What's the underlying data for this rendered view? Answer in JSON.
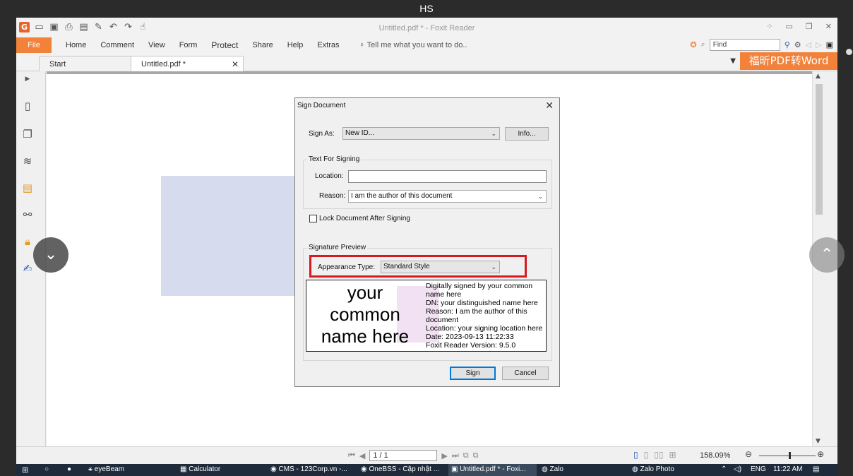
{
  "viewer": {
    "title": "HS"
  },
  "app": {
    "window_title": "Untitled.pdf * - Foxit Reader",
    "qa_icons": [
      "foxit-logo-icon",
      "open-folder-icon",
      "save-icon",
      "print-icon",
      "scan-icon",
      "new-icon",
      "undo-icon",
      "redo-icon",
      "hand-icon"
    ],
    "ribbon": {
      "file": "File",
      "tabs": [
        "Home",
        "Comment",
        "View",
        "Form",
        "Protect",
        "Share",
        "Help",
        "Extras"
      ],
      "tell_me": "Tell me what you want to do..",
      "find_placeholder": "Find"
    },
    "brand_banner": "福昕PDF转Word",
    "doc_tabs": {
      "start": "Start",
      "active": "Untitled.pdf *"
    }
  },
  "dialog": {
    "title": "Sign Document",
    "sign_as_label": "Sign As:",
    "sign_as_value": "New ID...",
    "info_button": "Info...",
    "text_group": "Text For Signing",
    "location_label": "Location:",
    "location_value": "",
    "reason_label": "Reason:",
    "reason_value": "I am the author of this document",
    "lock_label": "Lock Document After Signing",
    "lock_checked": false,
    "preview_group": "Signature Preview",
    "appearance_label": "Appearance Type:",
    "appearance_value": "Standard Style",
    "preview_name_lines": [
      "your",
      "common",
      "name here"
    ],
    "preview_info_lines": [
      "Digitally signed by your common",
      "name here",
      "DN: your distinguished name here",
      "Reason: I am the author of this",
      "document",
      "Location: your signing location here",
      "Date: 2023-09-13 11:22:33",
      "Foxit Reader Version: 9.5.0"
    ],
    "sign_button": "Sign",
    "cancel_button": "Cancel"
  },
  "status": {
    "page": "1 / 1",
    "zoom": "158.09%"
  },
  "taskbar": {
    "items": [
      "eyeBeam",
      "Calculator",
      "CMS - 123Corp.vn -...",
      "OneBSS - Cập nhật ...",
      "Untitled.pdf * - Foxi...",
      "Zalo",
      "Zalo Photo"
    ],
    "lang": "ENG",
    "time": "11:22 AM"
  }
}
